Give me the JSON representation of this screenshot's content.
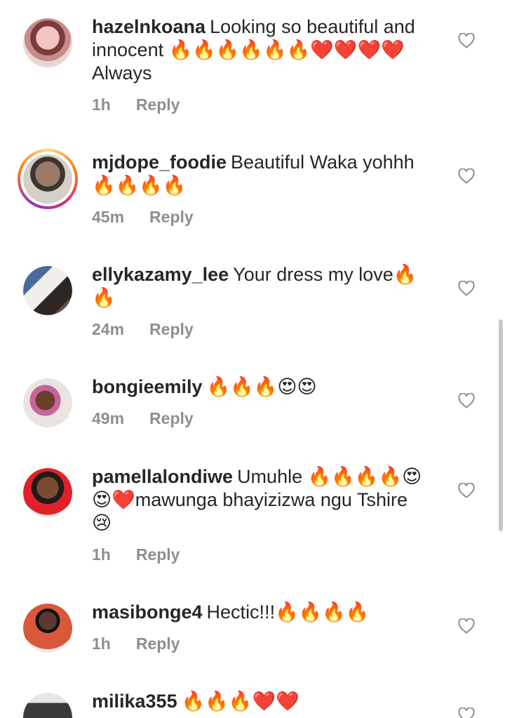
{
  "comments": [
    {
      "username": "hazelnkoana",
      "text": "Looking so beautiful and innocent 🔥🔥🔥🔥🔥🔥❤️❤️❤️❤️ Always",
      "time": "1h",
      "reply": "Reply",
      "story_ring": false
    },
    {
      "username": "mjdope_foodie",
      "text": "Beautiful Waka yohhh 🔥🔥🔥🔥",
      "time": "45m",
      "reply": "Reply",
      "story_ring": true
    },
    {
      "username": "ellykazamy_lee",
      "text": "Your dress my love🔥🔥",
      "time": "24m",
      "reply": "Reply",
      "story_ring": false
    },
    {
      "username": "bongieemily",
      "text": "🔥🔥🔥😍😍",
      "time": "49m",
      "reply": "Reply",
      "story_ring": false
    },
    {
      "username": "pamellalondiwe",
      "text": "Umuhle 🔥🔥🔥🔥😍😍❤️mawunga bhayizizwa ngu Tshire 😢",
      "time": "1h",
      "reply": "Reply",
      "story_ring": false
    },
    {
      "username": "masibonge4",
      "text": "Hectic!!!🔥🔥🔥🔥",
      "time": "1h",
      "reply": "Reply",
      "story_ring": false
    },
    {
      "username": "milika355",
      "text": "🔥🔥🔥❤️❤️",
      "time": "",
      "reply": "",
      "story_ring": false
    }
  ],
  "icons": {
    "like": "heart-outline-icon"
  },
  "colors": {
    "text": "#262626",
    "meta": "#8e8e8e",
    "background": "#ffffff"
  }
}
